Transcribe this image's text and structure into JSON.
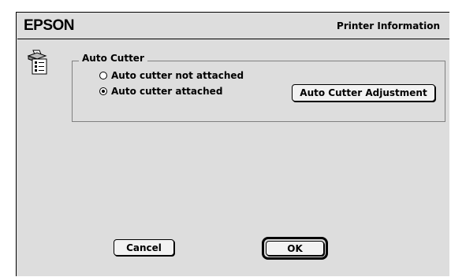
{
  "header": {
    "brand": "EPSON",
    "title": "Printer Information"
  },
  "icons": {
    "printer": "printer-settings-icon"
  },
  "auto_cutter": {
    "group_label": "Auto Cutter",
    "options": [
      {
        "label": "Auto cutter not attached",
        "selected": false
      },
      {
        "label": "Auto cutter attached",
        "selected": true
      }
    ],
    "adjust_button": "Auto Cutter Adjustment"
  },
  "footer": {
    "cancel_label": "Cancel",
    "ok_label": "OK"
  }
}
